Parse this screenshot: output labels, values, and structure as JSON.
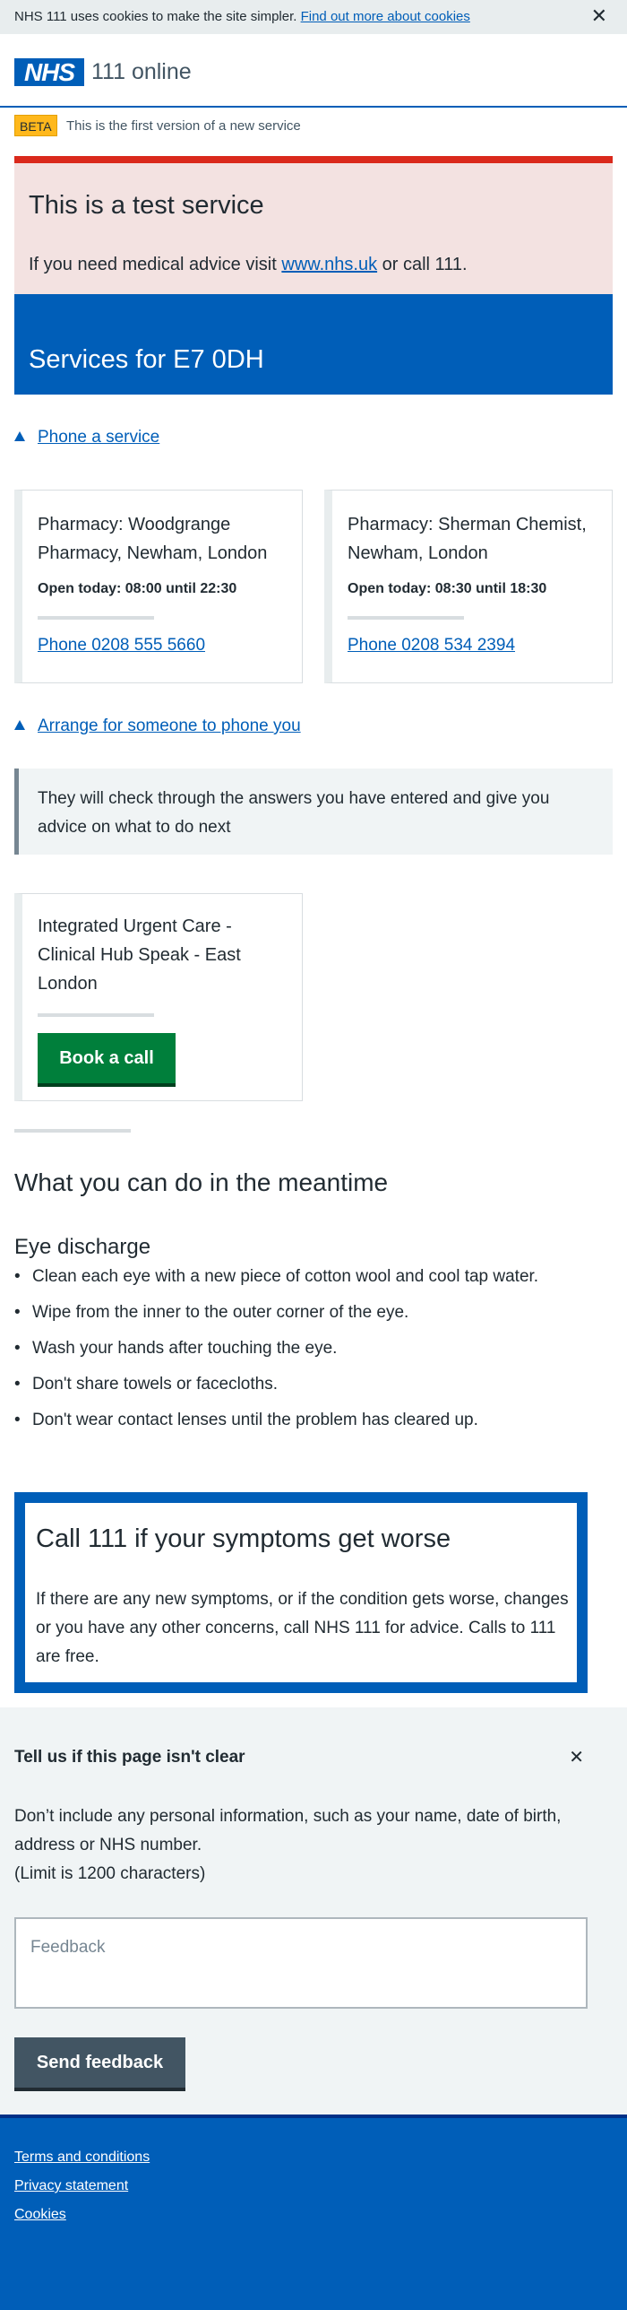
{
  "cookie": {
    "text": "NHS 111 uses cookies to make the site simpler.",
    "link": "Find out more about cookies",
    "close": "✕"
  },
  "header": {
    "logo": "NHS",
    "service": "111 online"
  },
  "beta": {
    "tag": "BETA",
    "text": "This is the first version of a new service"
  },
  "test": {
    "title": "This is a test service",
    "body_before": "If you need medical advice visit ",
    "body_link": "www.nhs.uk",
    "body_after": " or call 111."
  },
  "services": {
    "title": "Services for E7 0DH"
  },
  "phone_service": {
    "toggle": "Phone a service",
    "cards": [
      {
        "title": "Pharmacy: Woodgrange Pharmacy, Newham, London",
        "open": "Open today: 08:00 until 22:30",
        "phone": "Phone 0208 555 5660"
      },
      {
        "title": "Pharmacy: Sherman Chemist, Newham, London",
        "open": "Open today: 08:30 until 18:30",
        "phone": "Phone 0208 534 2394"
      }
    ]
  },
  "arrange_call": {
    "toggle": "Arrange for someone to phone you",
    "inset": "They will check through the answers you have entered and give you advice on what to do next",
    "card_title": "Integrated Urgent Care - Clinical Hub Speak - East London",
    "button": "Book a call"
  },
  "meantime": {
    "title": "What you can do in the meantime",
    "subtitle": "Eye discharge",
    "items": [
      "Clean each eye with a new piece of cotton wool and cool tap water.",
      "Wipe from the inner to the outer corner of the eye.",
      "Wash your hands after touching the eye.",
      "Don't share towels or facecloths.",
      "Don't wear contact lenses until the problem has cleared up."
    ]
  },
  "care_card": {
    "title": "Call 111 if your symptoms get worse",
    "body": "If there are any new symptoms, or if the condition gets worse, changes or you have any other concerns, call NHS 111 for advice. Calls to 111 are free."
  },
  "feedback": {
    "title": "Tell us if this page isn't clear",
    "close": "✕",
    "help": "Don’t include any personal information, such as your name, date of birth, address or NHS number.",
    "limit": "(Limit is 1200 characters)",
    "placeholder": "Feedback",
    "button": "Send feedback"
  },
  "footer": {
    "links": [
      "Terms and conditions",
      "Privacy statement",
      "Cookies"
    ]
  },
  "colors": {
    "nhs_blue": "#005eb8",
    "green_button": "#007f3b",
    "red_stripe": "#da291c",
    "beta_yellow": "#ffb81c"
  }
}
